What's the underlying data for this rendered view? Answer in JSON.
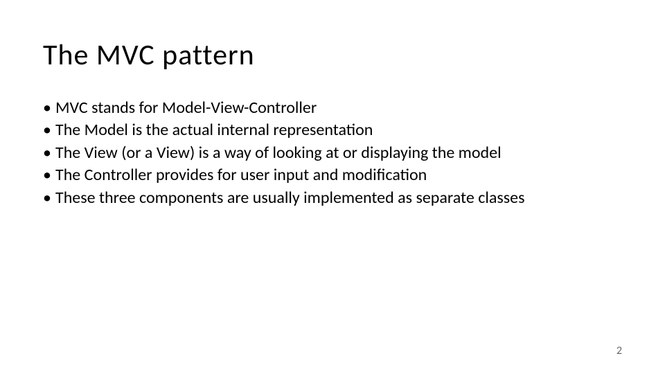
{
  "slide": {
    "title": "The MVC pattern",
    "bullets": [
      "MVC stands for Model-View-Controller",
      "The Model is the actual internal representation",
      "The View (or a View) is a way of looking at or displaying the model",
      "The Controller provides for user input and modification",
      "These three components are usually implemented as separate classes"
    ],
    "pageNumber": "2"
  }
}
